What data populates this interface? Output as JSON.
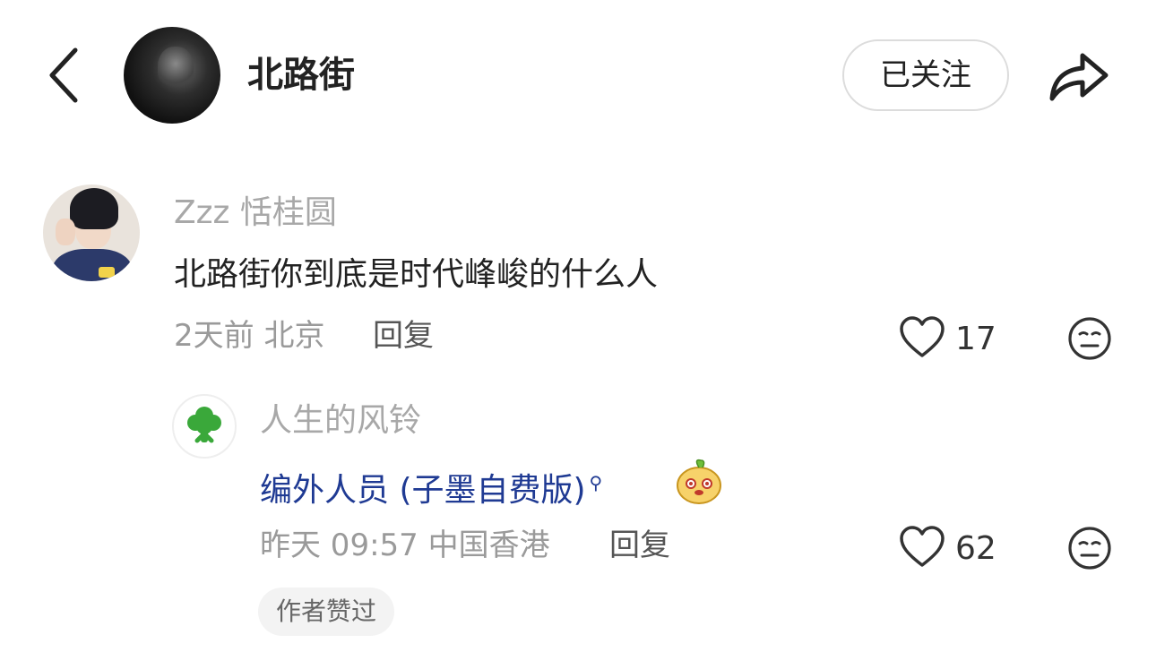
{
  "header": {
    "title": "北路街",
    "follow_label": "已关注",
    "icons": {
      "back": "chevron-left-icon",
      "share": "share-arrow-icon"
    }
  },
  "comments": [
    {
      "username": "Zzz 恬桂圆",
      "text": "北路街你到底是时代峰峻的什么人",
      "meta": "2天前 北京",
      "reply_label": "回复",
      "likes": "17",
      "replies": [
        {
          "username": "人生的风铃",
          "text": "编外人员 (子墨自费版)",
          "search_glyph": "⚲",
          "meta": "昨天 09:57 中国香港",
          "reply_label": "回复",
          "likes": "62",
          "badge": "作者赞过"
        }
      ]
    }
  ],
  "colors": {
    "link": "#1f3a93",
    "muted": "#9a9a9a",
    "accent_avatar": "#3aa83a"
  }
}
